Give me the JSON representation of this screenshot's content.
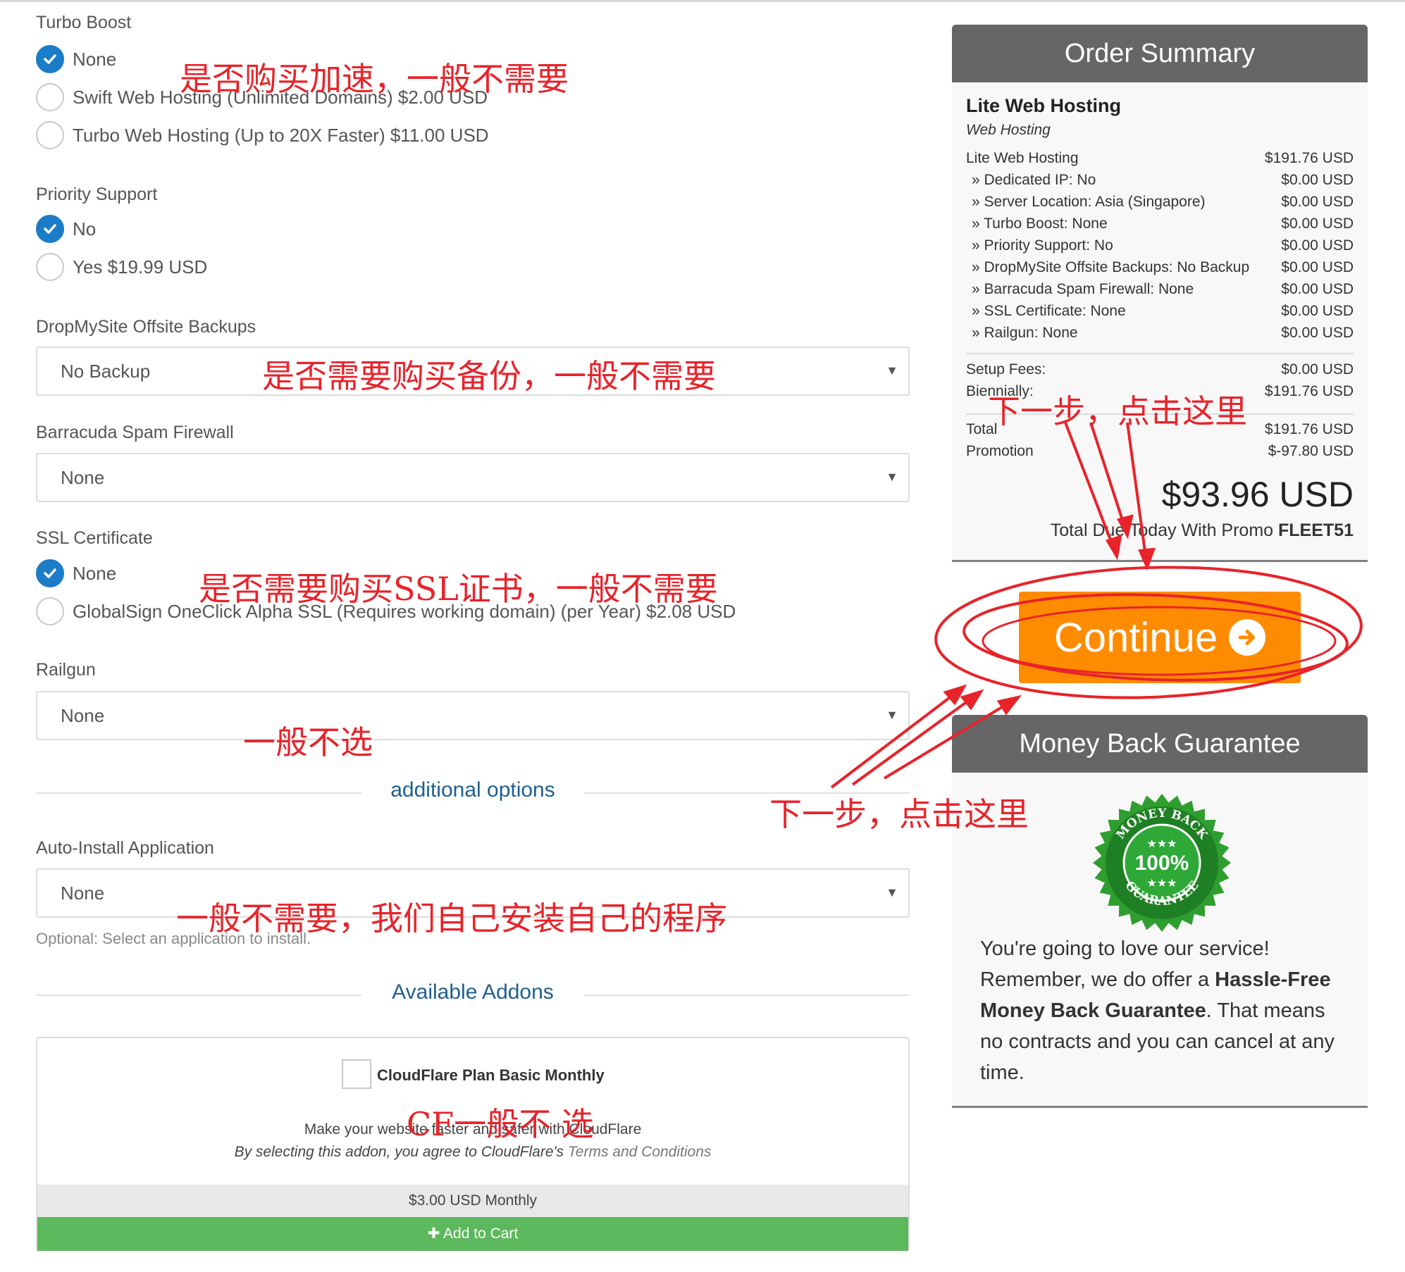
{
  "turbo_boost": {
    "label": "Turbo Boost",
    "options": [
      "None",
      "Swift Web Hosting (Unlimited Domains) $2.00 USD",
      "Turbo Web Hosting (Up to 20X Faster) $11.00 USD"
    ],
    "selected_index": 0
  },
  "priority_support": {
    "label": "Priority Support",
    "options": [
      "No",
      "Yes $19.99 USD"
    ],
    "selected_index": 0
  },
  "backups": {
    "label": "DropMySite Offsite Backups",
    "value": "No Backup"
  },
  "spam_firewall": {
    "label": "Barracuda Spam Firewall",
    "value": "None"
  },
  "ssl": {
    "label": "SSL Certificate",
    "options": [
      "None",
      "GlobalSign OneClick Alpha SSL (Requires working domain) (per Year) $2.08 USD"
    ],
    "selected_index": 0
  },
  "railgun": {
    "label": "Railgun",
    "value": "None"
  },
  "additional_options_title": "additional options",
  "auto_install": {
    "label": "Auto-Install Application",
    "value": "None",
    "help": "Optional: Select an application to install."
  },
  "addons_title": "Available Addons",
  "addon": {
    "name": "CloudFlare Plan Basic Monthly",
    "description": "Make your website faster and safer with CloudFlare",
    "terms_prefix": "By selecting this addon, you agree to CloudFlare's",
    "terms_link": "Terms and Conditions",
    "price": "$3.00 USD Monthly",
    "cart_label": "Add to Cart"
  },
  "order_summary": {
    "title": "Order Summary",
    "product": "Lite Web Hosting",
    "group": "Web Hosting",
    "lines": [
      {
        "label": "Lite Web Hosting",
        "amount": "$191.76 USD"
      },
      {
        "label": "» Dedicated IP: No",
        "amount": "$0.00 USD"
      },
      {
        "label": "» Server Location: Asia (Singapore)",
        "amount": "$0.00 USD"
      },
      {
        "label": "» Turbo Boost: None",
        "amount": "$0.00 USD"
      },
      {
        "label": "» Priority Support: No",
        "amount": "$0.00 USD"
      },
      {
        "label": "» DropMySite Offsite Backups: No Backup",
        "amount": "$0.00 USD"
      },
      {
        "label": "» Barracuda Spam Firewall: None",
        "amount": "$0.00 USD"
      },
      {
        "label": "» SSL Certificate: None",
        "amount": "$0.00 USD"
      },
      {
        "label": "» Railgun: None",
        "amount": "$0.00 USD"
      }
    ],
    "setup_fees_label": "Setup Fees:",
    "setup_fees": "$0.00 USD",
    "biennially_label": "Biennially:",
    "biennially": "$191.76 USD",
    "total_label": "Total",
    "total": "$191.76 USD",
    "promotion_label": "Promotion",
    "promotion": "$-97.80 USD",
    "due": "$93.96 USD",
    "due_caption": "Total Due Today With Promo",
    "promo_code": "FLEET51"
  },
  "continue_label": "Continue",
  "money_back": {
    "title": "Money Back Guarantee",
    "seal_top": "MONEY BACK",
    "seal_center": "100%",
    "seal_bottom": "GUARANTEE",
    "text_1": "You're going to love our service! Remember, we do offer a ",
    "text_bold": "Hassle-Free Money Back Guarantee",
    "text_2": ". That means no contracts and you can cancel at any time."
  },
  "annotations": {
    "turbo": "是否购买加速，一般不需要",
    "backup": "是否需要购买备份，一般不需要",
    "ssl": "是否需要购买SSL证书，一般不需要",
    "railgun": "一般不选",
    "autoinstall": "一般不需要，我们自己安装自己的程序",
    "cf": "CF一般不 选",
    "next_top": "下一步，点击这里",
    "next_bottom": "下一步，点击这里"
  },
  "colors": {
    "radio_checked": "#1b7cc8",
    "continue": "#ff8c00",
    "cart": "#5cb85c",
    "panel_header": "#666666",
    "section_title": "#1f5f8f",
    "annotation": "#e8232a"
  }
}
